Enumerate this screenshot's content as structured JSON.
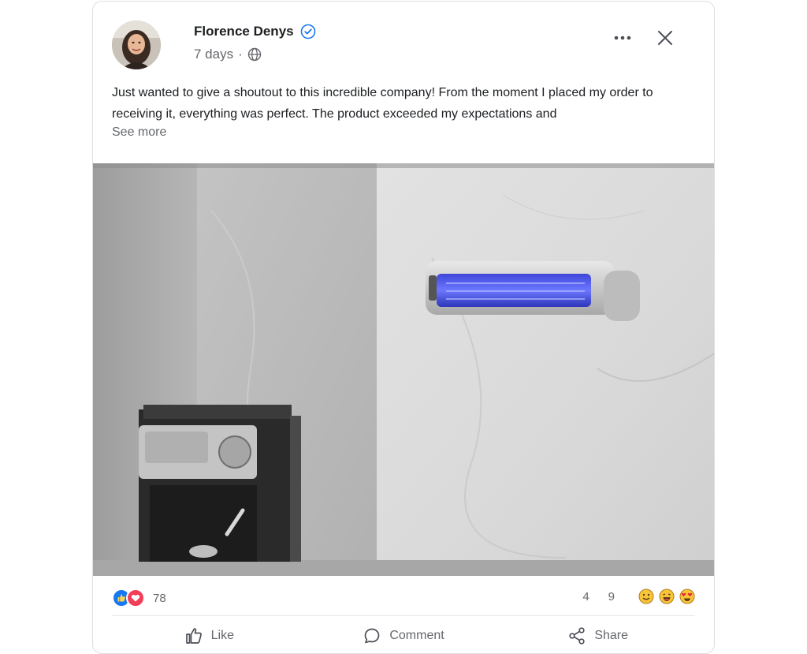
{
  "post": {
    "author": "Florence Denys",
    "timestamp": "7 days",
    "separator": "·",
    "visibility_icon": "globe-icon",
    "text": "Just wanted to give a shoutout to this incredible company! From the moment I placed my order to receiving it, everything was perfect. The product exceeded my expectations and",
    "see_more": "See more",
    "image_alt": "Photo of a wall-mounted electric heater above an espresso machine on a marble counter"
  },
  "stats": {
    "reaction_count": "78",
    "comments": "4",
    "shares": "9",
    "reaction_types": [
      "like",
      "love"
    ],
    "emoji_icons": [
      "smile-emoji-icon",
      "laugh-emoji-icon",
      "heart-eyes-emoji-icon"
    ]
  },
  "actions": {
    "like": "Like",
    "comment": "Comment",
    "share": "Share"
  },
  "colors": {
    "brand_blue": "#1877f2",
    "love_red": "#f33e58",
    "secondary_text": "#65676b",
    "emoji_yellow": "#f7c43a"
  }
}
